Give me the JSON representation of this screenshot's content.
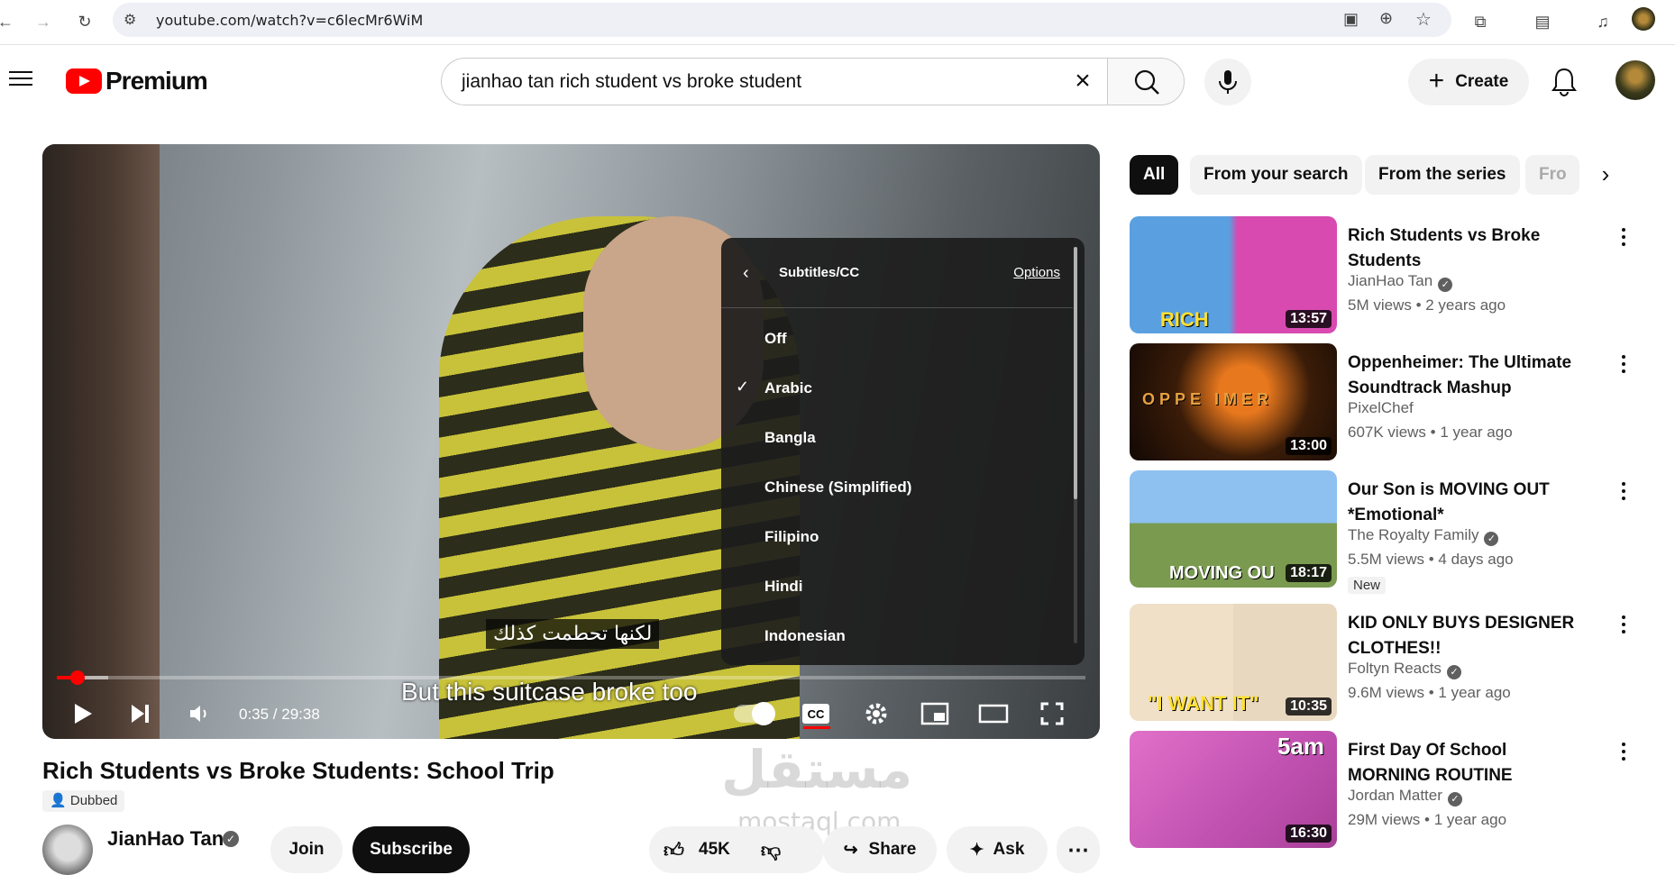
{
  "browser": {
    "url": "youtube.com/watch?v=c6lecMr6WiM"
  },
  "header": {
    "logo_text": "Premium",
    "search_value": "jianhao tan rich student vs broke student",
    "create_label": "Create"
  },
  "player": {
    "subtitle_arabic": "لكنها تحطمت كذلك",
    "subtitle_english": "But this suitcase broke too",
    "time": "0:35 / 29:38",
    "progress_played": 0.02,
    "progress_buffered": 0.05,
    "cc_label": "CC",
    "cc_menu": {
      "title": "Subtitles/CC",
      "options_label": "Options",
      "items": [
        {
          "label": "Off",
          "checked": ""
        },
        {
          "label": "Arabic",
          "checked": "✓"
        },
        {
          "label": "Bangla",
          "checked": ""
        },
        {
          "label": "Chinese (Simplified)",
          "checked": ""
        },
        {
          "label": "Filipino",
          "checked": ""
        },
        {
          "label": "Hindi",
          "checked": ""
        },
        {
          "label": "Indonesian",
          "checked": ""
        }
      ]
    }
  },
  "video": {
    "title": "Rich Students vs Broke Students: School Trip",
    "dubbed_label": "Dubbed",
    "channel_name": "JianHao Tan",
    "join_label": "Join",
    "subscribe_label": "Subscribe",
    "likes": "45K",
    "share_label": "Share",
    "ask_label": "Ask"
  },
  "watermark": {
    "arabic": "مستقل",
    "latin": "mostaql.com"
  },
  "chips": [
    "All",
    "From your search",
    "From the series",
    "Fro"
  ],
  "recommendations": [
    {
      "title": "Rich Students vs Broke Students",
      "channel": "JianHao Tan",
      "verified": true,
      "meta": "5M views • 2 years ago",
      "duration": "13:57",
      "overlay": "RICH",
      "badge": ""
    },
    {
      "title": "Oppenheimer: The Ultimate Soundtrack Mashup",
      "channel": "PixelChef",
      "verified": false,
      "meta": "607K views • 1 year ago",
      "duration": "13:00",
      "overlay": "OPPE  IMER",
      "badge": ""
    },
    {
      "title": "Our Son is MOVING OUT *Emotional*",
      "channel": "The Royalty Family",
      "verified": true,
      "meta": "5.5M views • 4 days ago",
      "duration": "18:17",
      "overlay": "MOVING OU",
      "badge": "New"
    },
    {
      "title": "KID ONLY BUYS DESIGNER CLOTHES!!",
      "channel": "Foltyn Reacts",
      "verified": true,
      "meta": "9.6M views • 1 year ago",
      "duration": "10:35",
      "overlay": "\"I WANT IT\"",
      "badge": ""
    },
    {
      "title": "First Day Of School MORNING ROUTINE",
      "channel": "Jordan Matter",
      "verified": true,
      "meta": "29M views • 1 year ago",
      "duration": "16:30",
      "overlay": "5am",
      "badge": ""
    }
  ]
}
